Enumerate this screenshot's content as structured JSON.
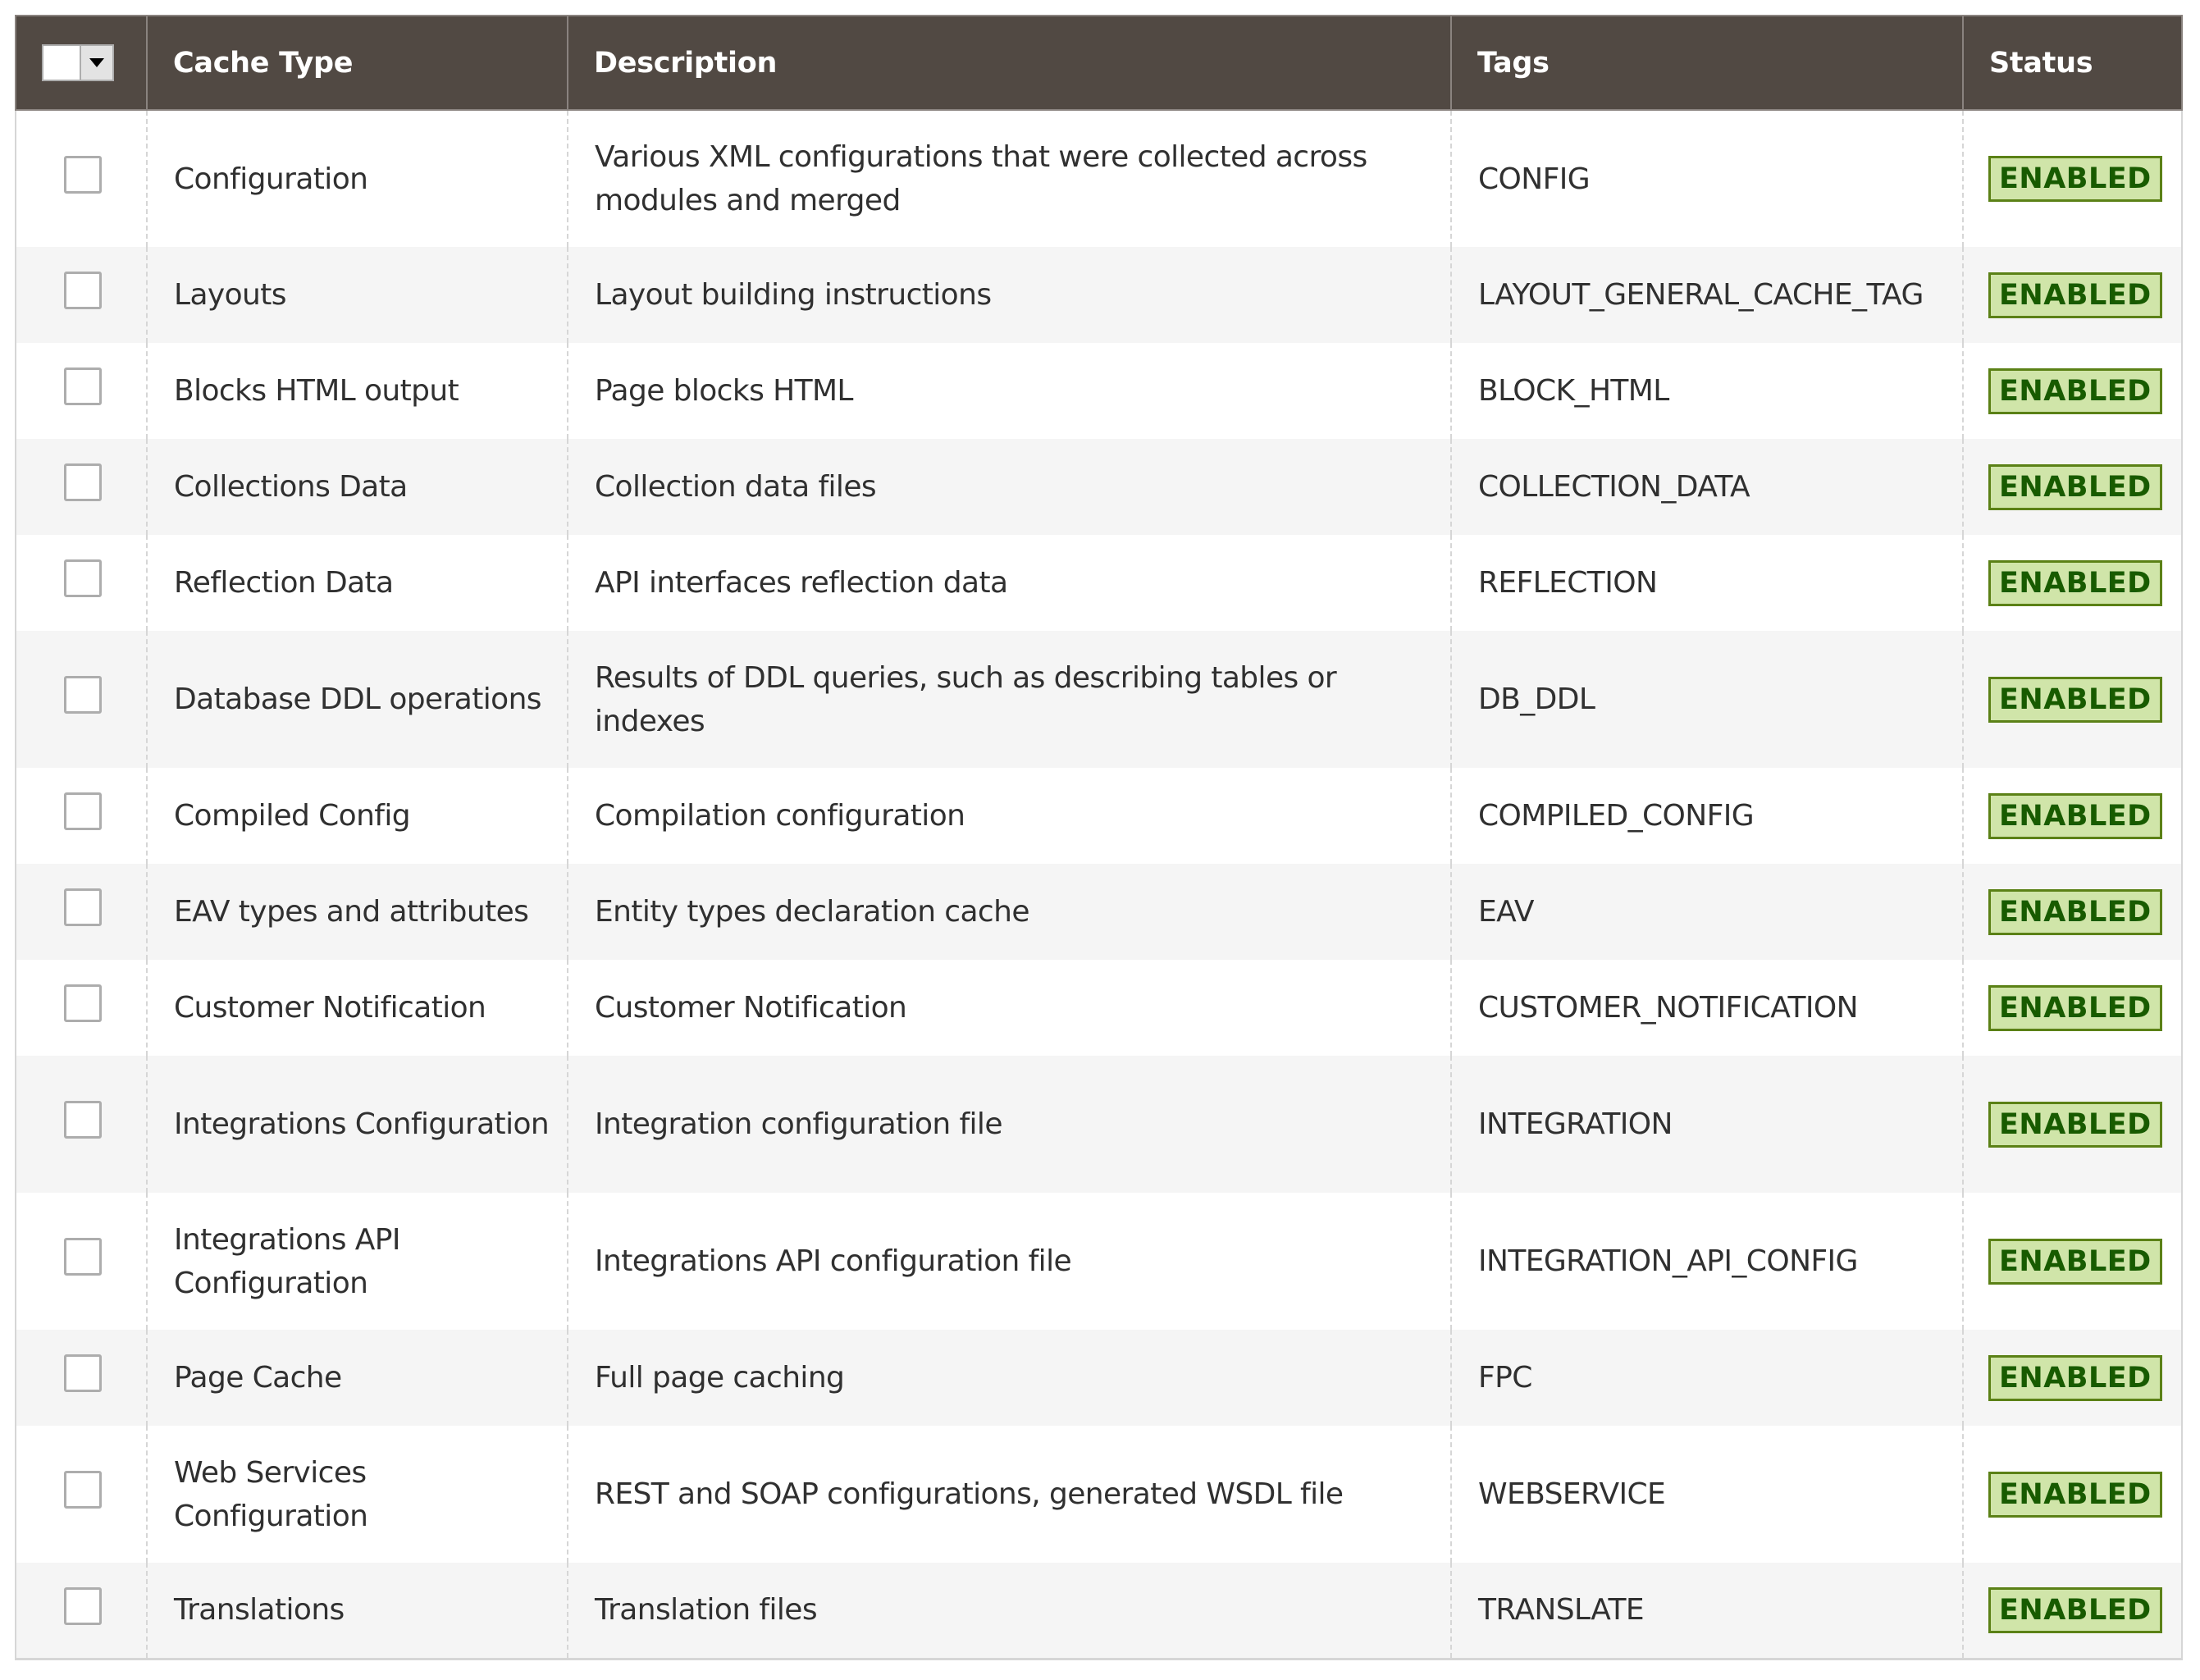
{
  "grid": {
    "mass_action": {
      "checkbox_checked": false,
      "dropdown_icon": "triangle-down-icon"
    },
    "columns": [
      "Cache Type",
      "Description",
      "Tags",
      "Status"
    ],
    "rows": [
      {
        "cache_type": "Configuration",
        "description": "Various XML configurations that were collected across modules and merged",
        "tags": "CONFIG",
        "status": "ENABLED",
        "checked": false
      },
      {
        "cache_type": "Layouts",
        "description": "Layout building instructions",
        "tags": "LAYOUT_GENERAL_CACHE_TAG",
        "status": "ENABLED",
        "checked": false
      },
      {
        "cache_type": "Blocks HTML output",
        "description": "Page blocks HTML",
        "tags": "BLOCK_HTML",
        "status": "ENABLED",
        "checked": false
      },
      {
        "cache_type": "Collections Data",
        "description": "Collection data files",
        "tags": "COLLECTION_DATA",
        "status": "ENABLED",
        "checked": false
      },
      {
        "cache_type": "Reflection Data",
        "description": "API interfaces reflection data",
        "tags": "REFLECTION",
        "status": "ENABLED",
        "checked": false
      },
      {
        "cache_type": "Database DDL operations",
        "description": "Results of DDL queries, such as describing tables or indexes",
        "tags": "DB_DDL",
        "status": "ENABLED",
        "checked": false
      },
      {
        "cache_type": "Compiled Config",
        "description": "Compilation configuration",
        "tags": "COMPILED_CONFIG",
        "status": "ENABLED",
        "checked": false
      },
      {
        "cache_type": "EAV types and attributes",
        "description": "Entity types declaration cache",
        "tags": "EAV",
        "status": "ENABLED",
        "checked": false
      },
      {
        "cache_type": "Customer Notification",
        "description": "Customer Notification",
        "tags": "CUSTOMER_NOTIFICATION",
        "status": "ENABLED",
        "checked": false
      },
      {
        "cache_type": "Integrations Configuration",
        "description": "Integration configuration file",
        "tags": "INTEGRATION",
        "status": "ENABLED",
        "checked": false
      },
      {
        "cache_type": "Integrations API Configuration",
        "description": "Integrations API configuration file",
        "tags": "INTEGRATION_API_CONFIG",
        "status": "ENABLED",
        "checked": false
      },
      {
        "cache_type": "Page Cache",
        "description": "Full page caching",
        "tags": "FPC",
        "status": "ENABLED",
        "checked": false
      },
      {
        "cache_type": "Web Services Configuration",
        "description": "REST and SOAP configurations, generated WSDL file",
        "tags": "WEBSERVICE",
        "status": "ENABLED",
        "checked": false
      },
      {
        "cache_type": "Translations",
        "description": "Translation files",
        "tags": "TRANSLATE",
        "status": "ENABLED",
        "checked": false
      }
    ]
  },
  "colors": {
    "header_bg": "#514943",
    "header_text": "#ffffff",
    "row_alt_bg": "#f5f5f5",
    "status_enabled_bg": "#d0e5a9",
    "status_enabled_border": "#5b8116",
    "status_enabled_text": "#185b00"
  }
}
